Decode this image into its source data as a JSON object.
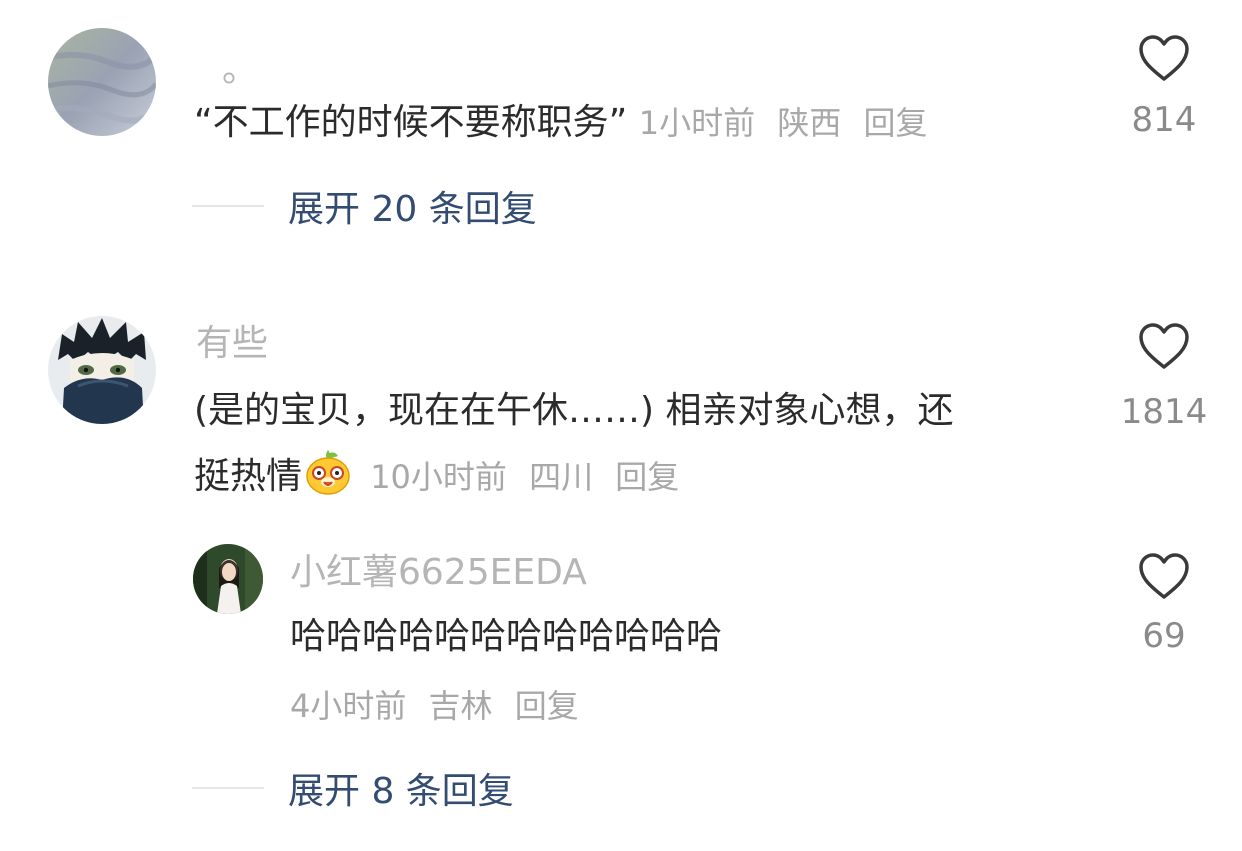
{
  "comments": [
    {
      "username": "。",
      "text": "“不工作的时候不要称职务”",
      "time": "1小时前",
      "location": "陕西",
      "reply_label": "回复",
      "likes": "814",
      "expand_label": "展开 20 条回复"
    },
    {
      "username": "有些",
      "text_line1": "(是的宝贝，现在在午休……) 相亲对象心想，还",
      "text_line2": "挺热情",
      "emoji_icon": "yellow-dog-face-emoji",
      "time": "10小时前",
      "location": "四川",
      "reply_label": "回复",
      "likes": "1814",
      "replies": [
        {
          "username": "小红薯6625EEDA",
          "text": "哈哈哈哈哈哈哈哈哈哈哈哈",
          "time": "4小时前",
          "location": "吉林",
          "reply_label": "回复",
          "likes": "69"
        }
      ],
      "expand_label": "展开 8 条回复"
    }
  ],
  "icons": {
    "like": "heart-outline-icon"
  },
  "colors": {
    "username": "#b5b5b5",
    "meta": "#a8a8a8",
    "expand_link": "#324c72",
    "text": "#2b2b2b"
  }
}
